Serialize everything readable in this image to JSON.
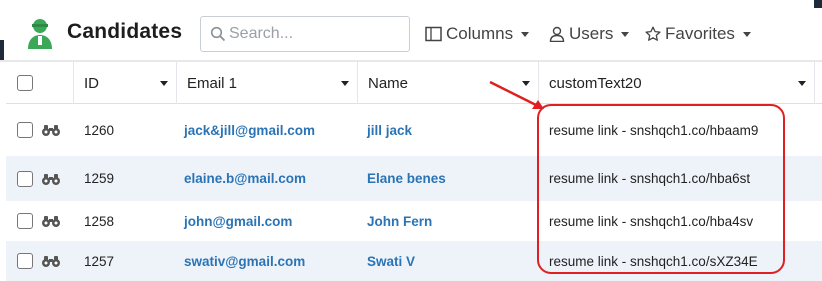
{
  "header": {
    "title": "Candidates",
    "search_placeholder": "Search...",
    "toolbar": [
      {
        "label": "Columns",
        "icon": "columns-icon"
      },
      {
        "label": "Users",
        "icon": "user-icon"
      },
      {
        "label": "Favorites",
        "icon": "star-icon"
      }
    ]
  },
  "table": {
    "columns": [
      "ID",
      "Email 1",
      "Name",
      "customText20"
    ],
    "rows": [
      {
        "id": "1260",
        "email": "jack&jill@gmail.com",
        "name": "jill jack",
        "custom": "resume link - snshqch1.co/hbaam9"
      },
      {
        "id": "1259",
        "email": "elaine.b@mail.com",
        "name": "Elane benes",
        "custom": "resume link - snshqch1.co/hba6st"
      },
      {
        "id": "1258",
        "email": "john@gmail.com",
        "name": "John Fern",
        "custom": "resume link - snshqch1.co/hba4sv"
      },
      {
        "id": "1257",
        "email": "swativ@gmail.com",
        "name": "Swati V",
        "custom": "resume link - snshqch1.co/sXZ34E"
      }
    ]
  },
  "colors": {
    "link": "#2a74b5",
    "row_alt": "#eef3fa",
    "annotation": "#e02020",
    "logo": "#3aa857"
  }
}
